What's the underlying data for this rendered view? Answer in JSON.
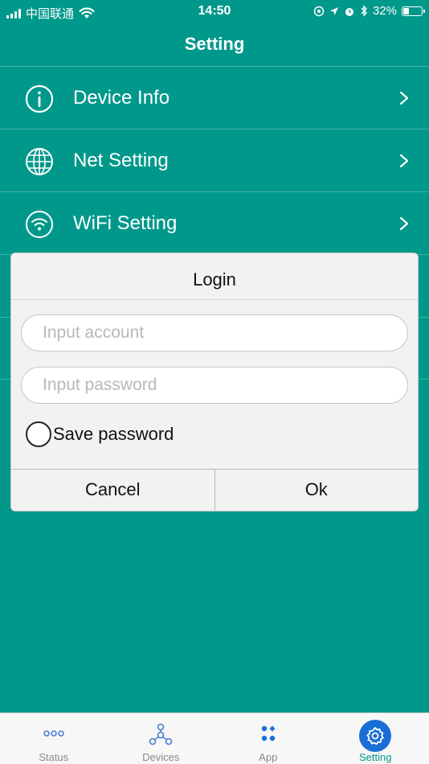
{
  "status_bar": {
    "carrier": "中国联通",
    "time": "14:50",
    "battery": "32%",
    "battery_level": 0.32
  },
  "nav": {
    "title": "Setting"
  },
  "menu": {
    "items": [
      {
        "label": "Device Info",
        "icon": "info-icon"
      },
      {
        "label": "Net Setting",
        "icon": "globe-icon"
      },
      {
        "label": "WiFi Setting",
        "icon": "wifi-icon"
      }
    ]
  },
  "dialog": {
    "title": "Login",
    "account_placeholder": "Input account",
    "password_placeholder": "Input password",
    "account_value": "",
    "password_value": "",
    "save_password_label": "Save password",
    "save_password_checked": false,
    "cancel_label": "Cancel",
    "ok_label": "Ok"
  },
  "tabs": [
    {
      "label": "Status",
      "icon": "dots-icon",
      "active": false
    },
    {
      "label": "Devices",
      "icon": "network-icon",
      "active": false
    },
    {
      "label": "App",
      "icon": "grid-dots-icon",
      "active": false
    },
    {
      "label": "Setting",
      "icon": "gear-icon",
      "active": true
    }
  ],
  "colors": {
    "background": "#00988a",
    "accent": "#1a6fd6",
    "active_tab_text": "#00988a",
    "inactive_tab_icon": "#4a7fd4"
  }
}
